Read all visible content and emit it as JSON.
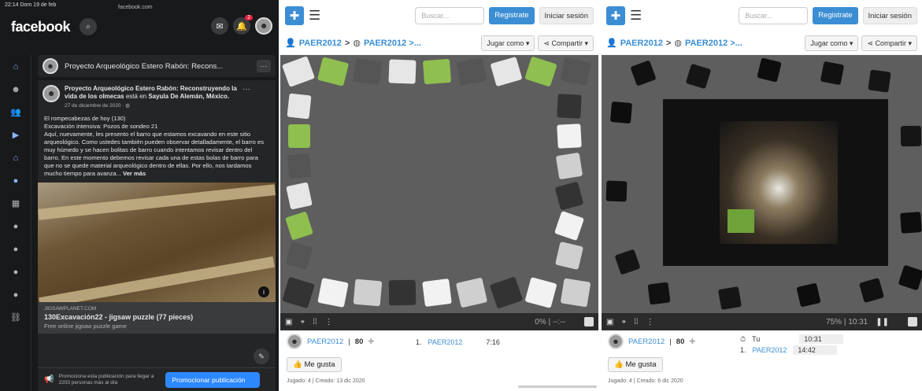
{
  "facebook": {
    "status_time": "22:14  Dom 19 de feb",
    "url": "facebook.com",
    "logo": "facebook",
    "notification_count": "2",
    "group_title": "Proyecto Arqueológico Estero Rabón: Recons...",
    "post_author": "Proyecto Arqueológico Estero Rabón: Reconstruyendo la vida de los olmecas",
    "post_location_prefix": "está en",
    "post_location": "Sayula De Alemán, México.",
    "post_date": "27 de diciembre de 2020 · ",
    "post_lines": [
      "El rompecabezas de hoy (130)",
      "Excavación intensiva: Pozos de sondeo 21",
      "Aquí, nuevamente, les presento el barro que estamos excavando en este sitio arqueológico. Como ustedes también pueden observar detalladamente, el barro es muy húmedo y se hacen bolitas de barro cuando intentamos revisar dentro del barro. En este momento debemos revisar cada una de estas bolas de barro para que no se quede material arqueológico dentro de ellas. Por ello, nos tardamos mucho tiempo para avanza... "
    ],
    "see_more": "Ver más",
    "link_domain": "JIGSAWPLANET.COM",
    "link_title": "130Excavación22 - jigsaw puzzle (77 pieces)",
    "link_subtitle": "Free online jigsaw puzzle game",
    "promo_text": "Promociona esta publicación para llegar a 2203 personas más al día",
    "promo_button": "Promocionar publicación"
  },
  "jigsaw_left": {
    "search_placeholder": "Buscar...",
    "register": "Registrate",
    "login": "Iniciar sesión",
    "crumb_user": "PAER2012",
    "crumb_sep": ">",
    "crumb_album": "PAER2012 >...",
    "play_as": "Jugar como",
    "share": "Compartir",
    "progress": "0%  |  --:--",
    "player": "PAER2012",
    "pieces": "80",
    "rank": "1.",
    "rank_user": "PAER2012",
    "rank_time": "7:16",
    "like": "Me gusta",
    "meta": "Jugado: 4 | Creado: 13 dic 2020"
  },
  "jigsaw_right": {
    "search_placeholder": "Buscar...",
    "register": "Registrate",
    "login": "Iniciar sesión",
    "crumb_user": "PAER2012",
    "crumb_sep": ">",
    "crumb_album": "PAER2012 >...",
    "play_as": "Jugar como",
    "share": "Compartir",
    "progress": "75%  |  10:31",
    "player": "PAER2012",
    "pieces": "80",
    "you_label": "Tu",
    "you_time": "10:31",
    "rank": "1.",
    "rank_user": "PAER2012",
    "rank_time": "14:42",
    "like": "Me gusta",
    "meta": "Jugado: 4 | Creado: 6 dic 2020"
  },
  "colors": {
    "fb_bg": "#18191a",
    "fb_blue": "#2d88ff",
    "jigsaw_blue": "#3b8ed3",
    "board": "#5e5e5e"
  }
}
